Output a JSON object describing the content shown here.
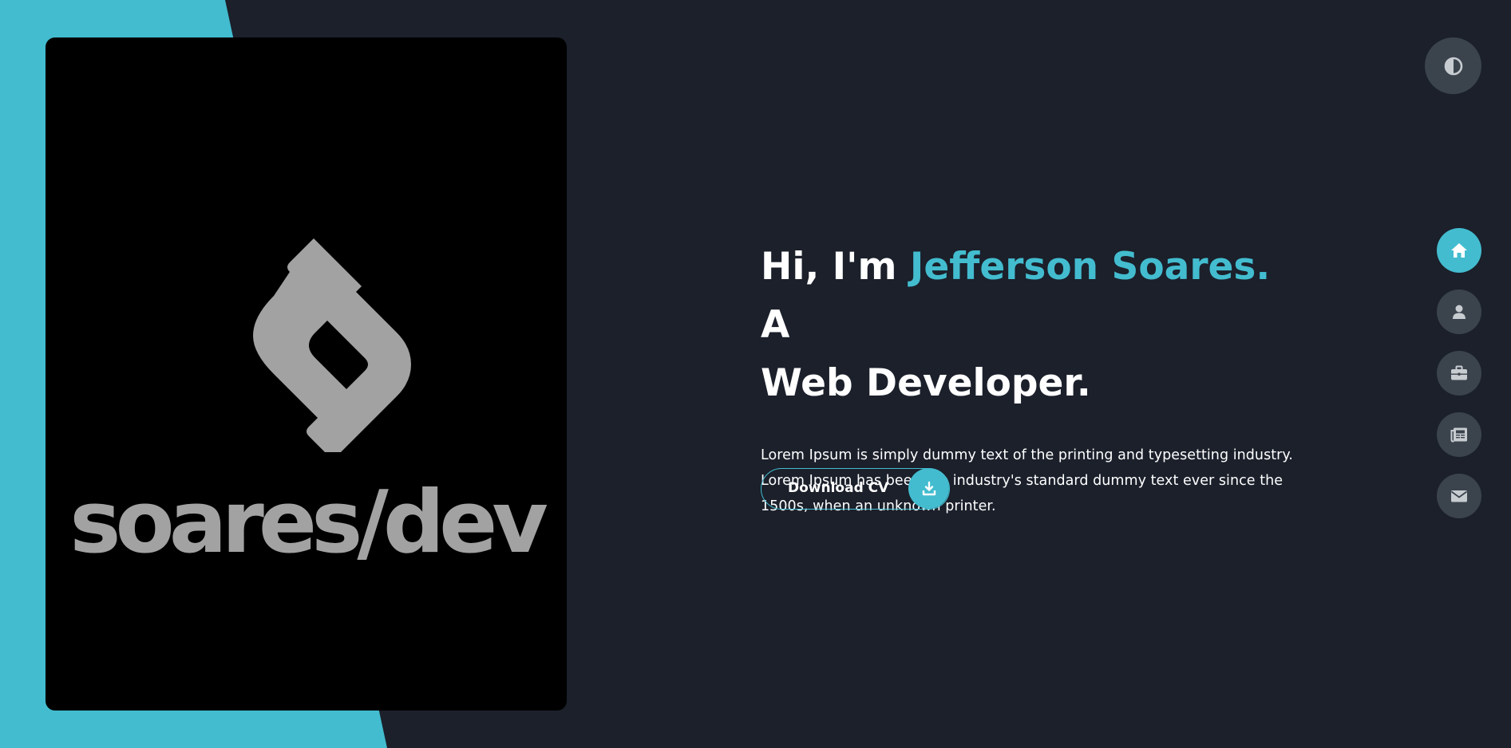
{
  "logo": {
    "word": "soares/dev"
  },
  "hero": {
    "title_before": "Hi, I'm ",
    "title_name": "Jefferson Soares.",
    "title_line1_after": " A",
    "title_line2": "Web Developer.",
    "description": "Lorem Ipsum is simply dummy text of the printing and typesetting industry. Lorem Ipsum has been the industry's standard dummy text ever since the 1500s, when an unknown printer."
  },
  "cv_button": {
    "label": "Download CV",
    "icon": "download-icon"
  },
  "theme_toggle": {
    "icon": "half-circle-contrast-icon"
  },
  "nav": [
    {
      "icon": "home-icon",
      "active": true
    },
    {
      "icon": "user-icon",
      "active": false
    },
    {
      "icon": "briefcase-icon",
      "active": false
    },
    {
      "icon": "newspaper-icon",
      "active": false
    },
    {
      "icon": "envelope-icon",
      "active": false
    }
  ],
  "colors": {
    "background": "#1b202b",
    "accent": "#43bccf",
    "nav_button": "#3b434c",
    "logo_gray": "#a2a2a2"
  }
}
